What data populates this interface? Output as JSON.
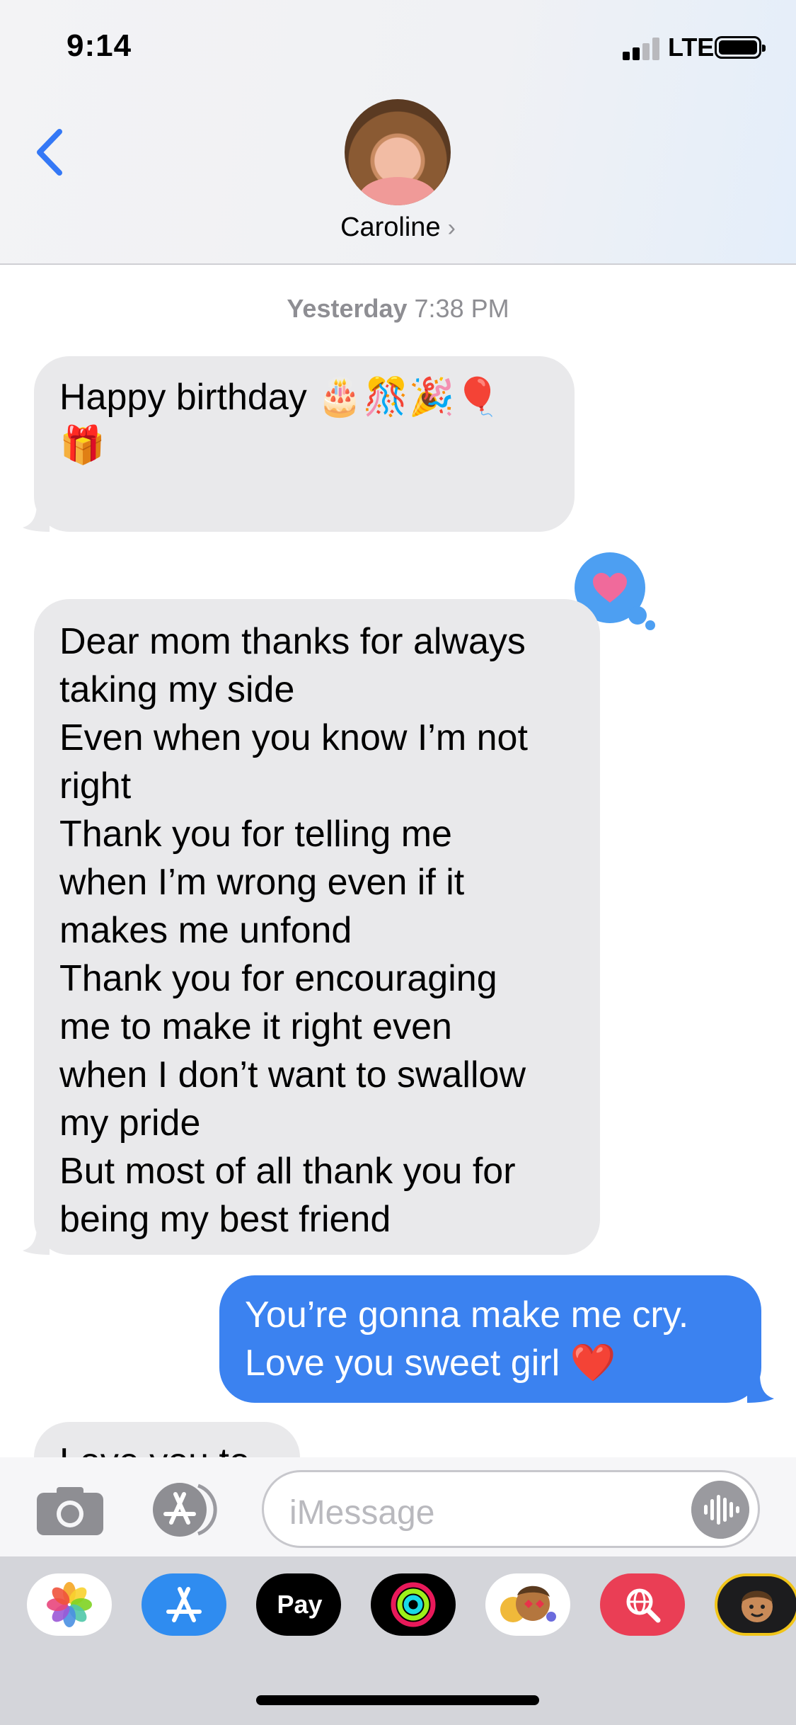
{
  "status_bar": {
    "time": "9:14",
    "network": "LTE",
    "signal_bars": 2,
    "signal_total": 4,
    "battery_level": 1.0
  },
  "header": {
    "contact_name": "Caroline",
    "chevron": "›",
    "back_icon": "chevron-left-icon"
  },
  "conversation": {
    "timestamp_day": "Yesterday",
    "timestamp_time": "7:38 PM",
    "msg1": {
      "lines": [
        "Happy birthday 🎂🎊🎉🎈",
        "🎁"
      ]
    },
    "msg2": {
      "lines": [
        "Dear mom thanks for always",
        "taking my side",
        "Even when you know I’m not",
        "right",
        "Thank you for telling me",
        "when I’m wrong even if it",
        "makes me unfond",
        "Thank you for encouraging",
        "me to make it right even",
        "when I don’t want to swallow",
        "my pride",
        "But most of all thank you for",
        "being my best friend"
      ],
      "tapback": "heart"
    },
    "msg3": {
      "lines": [
        "You’re gonna make me cry.",
        "Love you sweet girl ❤️"
      ]
    },
    "msg4": {
      "lines": [
        "Love you to"
      ]
    }
  },
  "input_bar": {
    "placeholder": "iMessage"
  },
  "app_drawer": {
    "apps": [
      "Photos",
      "App Store",
      "Apple Pay",
      "Activity",
      "Memoji Stickers",
      "Web Search",
      "Memoji"
    ],
    "apple_pay_label": "Pay"
  },
  "colors": {
    "sent_bubble": "#3b82f0",
    "received_bubble": "#e9e9eb",
    "accent": "#3478f6"
  }
}
